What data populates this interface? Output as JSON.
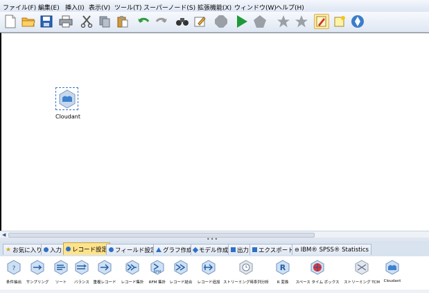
{
  "menu": [
    "ファイル(F)",
    "編集(E)",
    "挿入(I)",
    "表示(V)",
    "ツール(T)",
    "スーパーノード(S)",
    "拡張機能(X)",
    "ウィンドウ(W)",
    "ヘルプ(H)"
  ],
  "toolbar_icons": [
    "new-file-icon",
    "open-folder-icon",
    "save-icon",
    "print-icon",
    "cut-icon",
    "copy-icon",
    "paste-icon",
    "undo-icon",
    "redo-icon",
    "find-icon",
    "edit-icon",
    "stop-icon",
    "run-icon",
    "run-selection-icon",
    "star-icon",
    "supernode-icon",
    "annotation-icon",
    "new-comment-icon",
    "modeler-icon"
  ],
  "canvas": {
    "node_label": "Cloudant"
  },
  "tabs": [
    "お気に入り",
    "入力",
    "レコード設定",
    "フィールド設定",
    "グラフ作成",
    "モデル作成",
    "出力",
    "エクスポート",
    "IBM® SPSS® Statistics"
  ],
  "palette": [
    "条件抽出",
    "サンプリング",
    "ソート",
    "バランス",
    "重複レコード",
    "レコード集計",
    "RFM 集計",
    "レコード結合",
    "レコード追加",
    "ストリーミング時系列分析",
    "R 変換",
    "スペース タイム ボックス",
    "ストリーミング TCM",
    "Cloudant"
  ],
  "colors": {
    "accent": "#2f6fc7",
    "active_tab": "#ffe38c"
  }
}
